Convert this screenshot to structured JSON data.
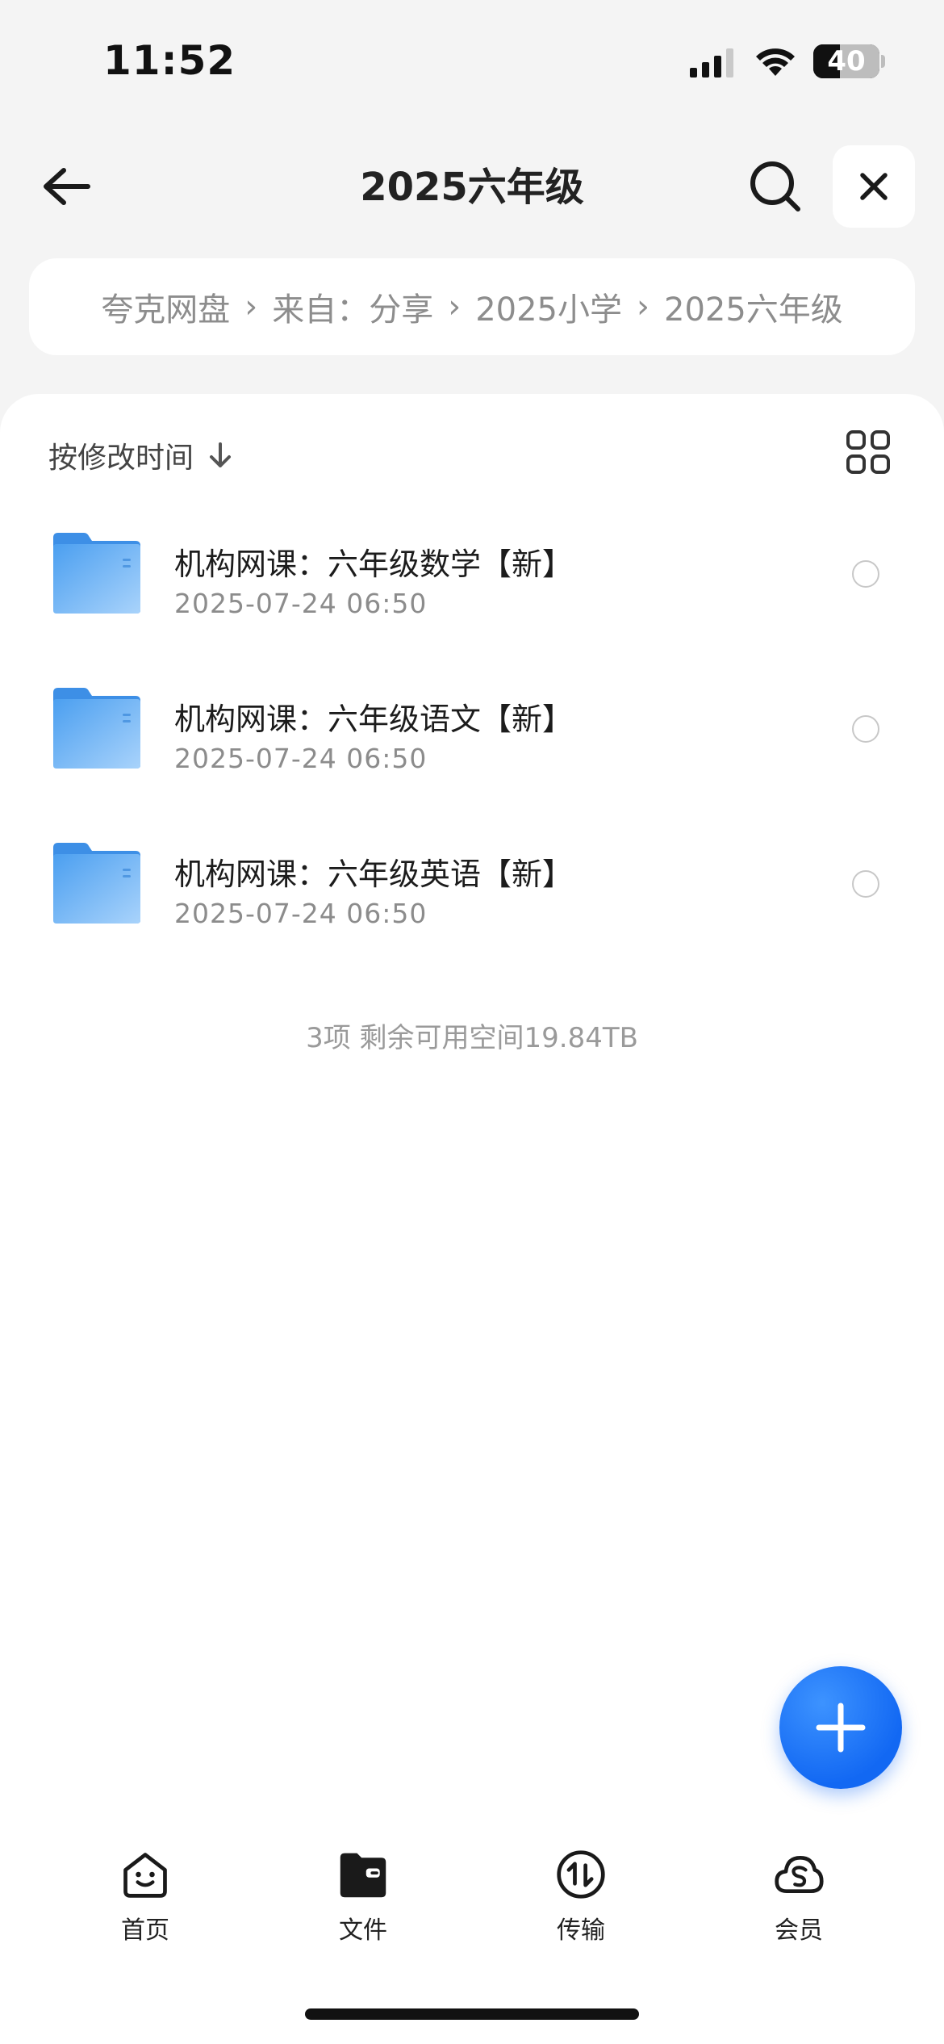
{
  "status": {
    "time": "11:52",
    "battery": "40",
    "battery_level": 0.4
  },
  "header": {
    "title": "2025六年级"
  },
  "breadcrumb": [
    "夸克网盘",
    "来自：分享",
    "2025小学",
    "2025六年级"
  ],
  "sort": {
    "label": "按修改时间"
  },
  "files": [
    {
      "name": "机构网课：六年级数学【新】",
      "date": "2025-07-24 06:50"
    },
    {
      "name": "机构网课：六年级语文【新】",
      "date": "2025-07-24 06:50"
    },
    {
      "name": "机构网课：六年级英语【新】",
      "date": "2025-07-24 06:50"
    }
  ],
  "footer": {
    "info": "3项 剩余可用空间19.84TB"
  },
  "tabs": [
    {
      "label": "首页",
      "icon": "smile-home-icon"
    },
    {
      "label": "文件",
      "icon": "folder-icon"
    },
    {
      "label": "传输",
      "icon": "transfer-icon"
    },
    {
      "label": "会员",
      "icon": "cloud-s-icon"
    }
  ],
  "colors": {
    "accent": "#1268f3",
    "folder": "#5aa8f0",
    "background": "#f4f4f4"
  }
}
